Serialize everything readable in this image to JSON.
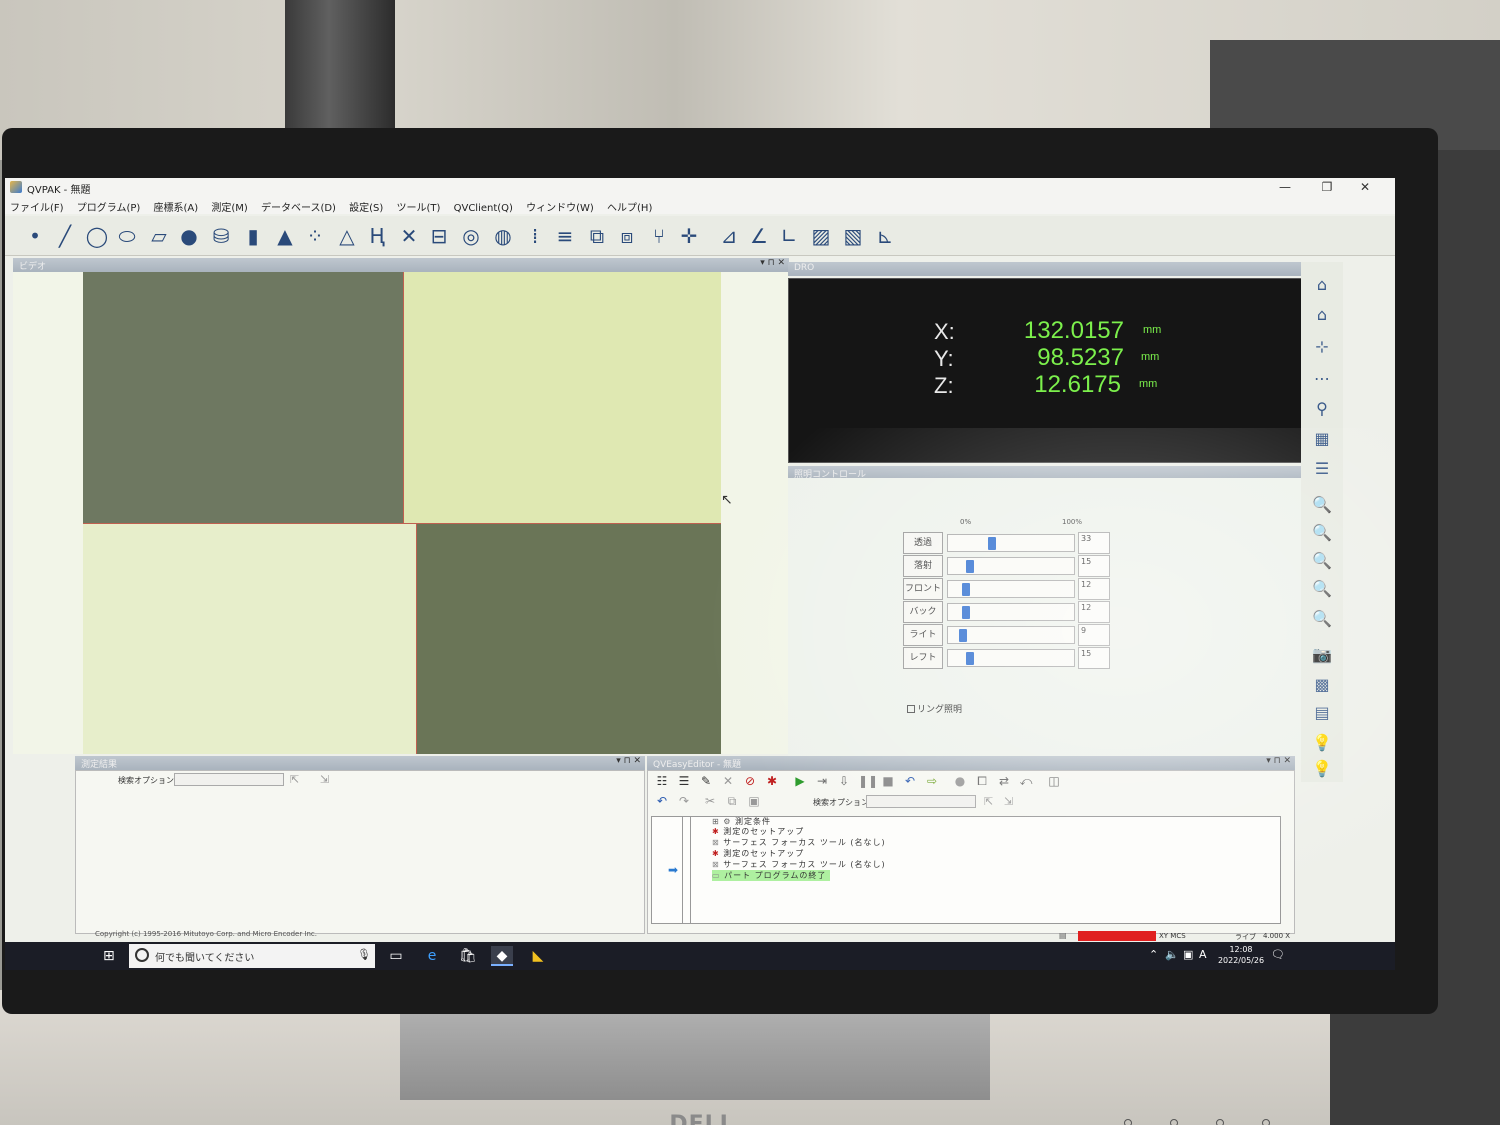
{
  "window": {
    "title": "QVPAK - 無題",
    "minimize": "—",
    "maximize": "❐",
    "close": "✕"
  },
  "menu": [
    "ファイル(F)",
    "プログラム(P)",
    "座標系(A)",
    "測定(M)",
    "データベース(D)",
    "設定(S)",
    "ツール(T)",
    "QVClient(Q)",
    "ウィンドウ(W)",
    "ヘルプ(H)"
  ],
  "video": {
    "title": "ビデオ",
    "controls": "▾ ⊓ ✕"
  },
  "dro": {
    "title": "DRO",
    "controls": "▾ ⊓ ✕",
    "x_label": "X:",
    "x_value": "132.0157",
    "x_unit": "mm",
    "y_label": "Y:",
    "y_value": "98.5237",
    "y_unit": "mm",
    "z_label": "Z:",
    "z_value": "12.6175",
    "z_unit": "mm"
  },
  "lighting": {
    "title": "照明コントロール",
    "controls": "▾ ⊓ ✕",
    "scale_min": "0%",
    "scale_max": "100%",
    "rows": [
      {
        "name": "透過",
        "value": "33",
        "level": 0.33
      },
      {
        "name": "落射",
        "value": "15",
        "level": 0.15
      },
      {
        "name": "フロント",
        "value": "12",
        "level": 0.12
      },
      {
        "name": "バック",
        "value": "12",
        "level": 0.12
      },
      {
        "name": "ライト",
        "value": "9",
        "level": 0.09
      },
      {
        "name": "レフト",
        "value": "15",
        "level": 0.15
      }
    ],
    "ring_label": "リング照明"
  },
  "results": {
    "title": "測定結果",
    "controls": "▾ ⊓ ✕",
    "search_label": "検索オプション:"
  },
  "editor": {
    "title": "QVEasyEditor - 無題",
    "controls": "▾ ⊓ ✕",
    "search_label": "検索オプション:",
    "tree": [
      "測定条件",
      "測定のセットアップ",
      "サーフェス フォーカス ツール (名なし)",
      "測定のセットアップ",
      "サーフェス フォーカス ツール (名なし)",
      "パート プログラムの終了"
    ]
  },
  "copyright": "Copyright (c) 1995-2016 Mitutoyo Corp. and Micro Encoder Inc.",
  "status": {
    "coord": "XY  MCS",
    "mode": "ライブ",
    "zoom": "4.000 X"
  },
  "taskbar": {
    "search_placeholder": "何でも聞いてください",
    "time": "12:08",
    "date": "2022/05/26",
    "ime": "A"
  },
  "monitor_brand": "DELL",
  "colors": {
    "dro_text": "#7cf04c",
    "dro_bg": "#151515",
    "slider_thumb": "#2f6fd0",
    "status_red": "#e02020"
  }
}
